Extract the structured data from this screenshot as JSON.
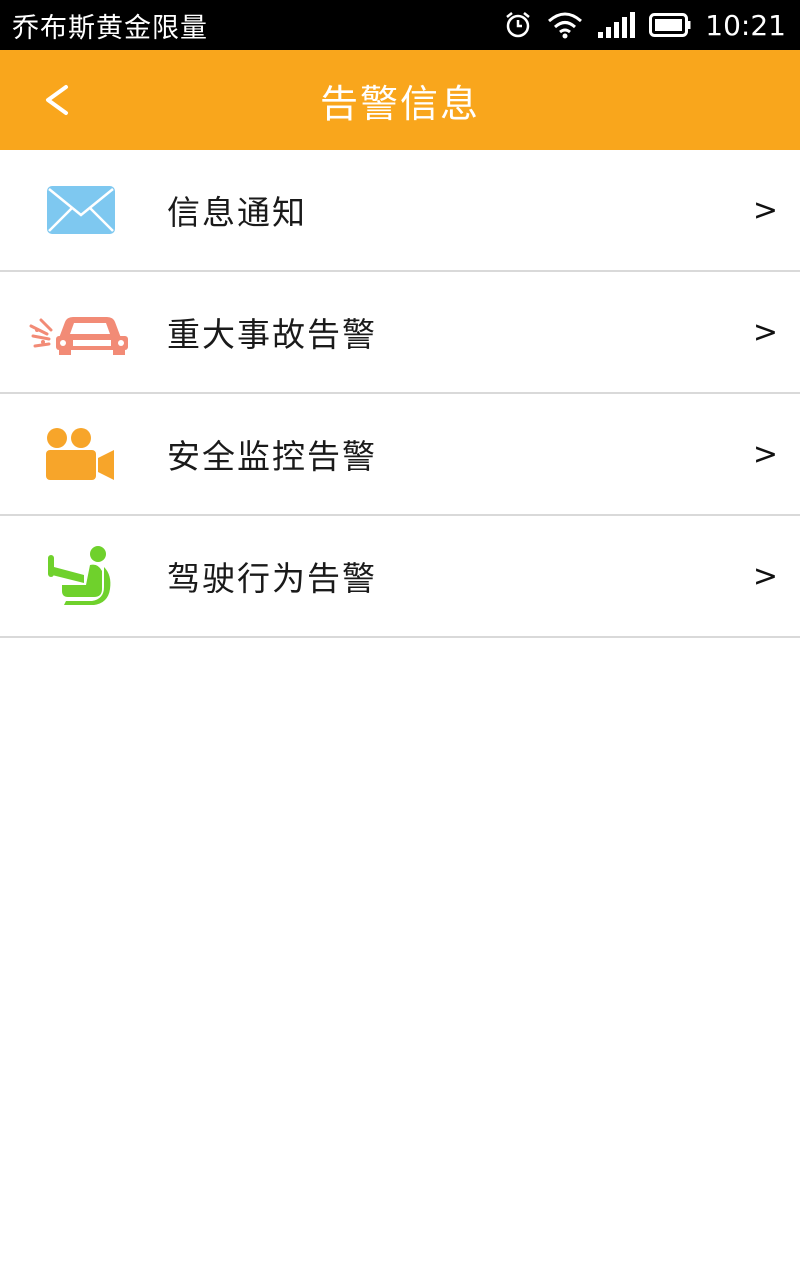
{
  "status_bar": {
    "carrier": "乔布斯黄金限量",
    "time": "10:21",
    "icons": [
      "alarm-icon",
      "wifi-icon",
      "signal-icon",
      "battery-icon"
    ]
  },
  "nav": {
    "back_label": "<",
    "title": "告警信息",
    "background_color": "#f9a61c"
  },
  "menu": {
    "items": [
      {
        "label": "信息通知",
        "icon": "envelope-icon",
        "chevron": ">",
        "icon_color": "#7ec8f0"
      },
      {
        "label": "重大事故告警",
        "icon": "car-crash-icon",
        "chevron": ">",
        "icon_color": "#f28b76"
      },
      {
        "label": "安全监控告警",
        "icon": "video-camera-icon",
        "chevron": ">",
        "icon_color": "#f7a52a"
      },
      {
        "label": "驾驶行为告警",
        "icon": "driver-seat-icon",
        "chevron": ">",
        "icon_color": "#6fd12c"
      }
    ]
  }
}
